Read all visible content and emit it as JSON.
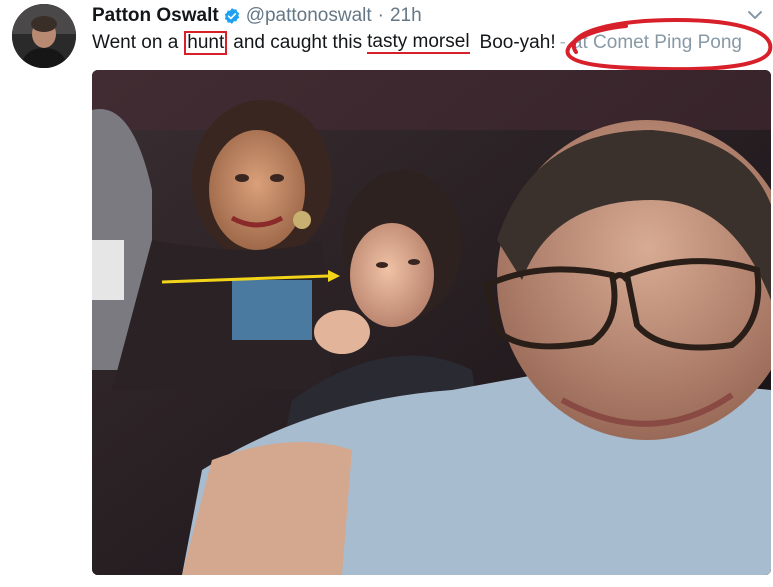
{
  "tweet": {
    "display_name": "Patton Oswalt",
    "handle": "@pattonoswalt",
    "separator": "·",
    "time": "21h",
    "text_parts": {
      "t1": "Went on a",
      "hunt": "hunt",
      "t2": "and caught this",
      "tasty_morsel": "tasty morsel",
      "t3": "Boo-yah!",
      "loc_sep": "-",
      "location": "at Comet Ping Pong"
    }
  },
  "icons": {
    "verified": "verified-badge-icon",
    "caret": "chevron-down-icon"
  },
  "annotation_colors": {
    "red": "#d8202a",
    "yellow_arrow": "#f2d41a"
  },
  "colors": {
    "name": "#14171a",
    "muted": "#657786",
    "verified_blue": "#1da1f2"
  }
}
